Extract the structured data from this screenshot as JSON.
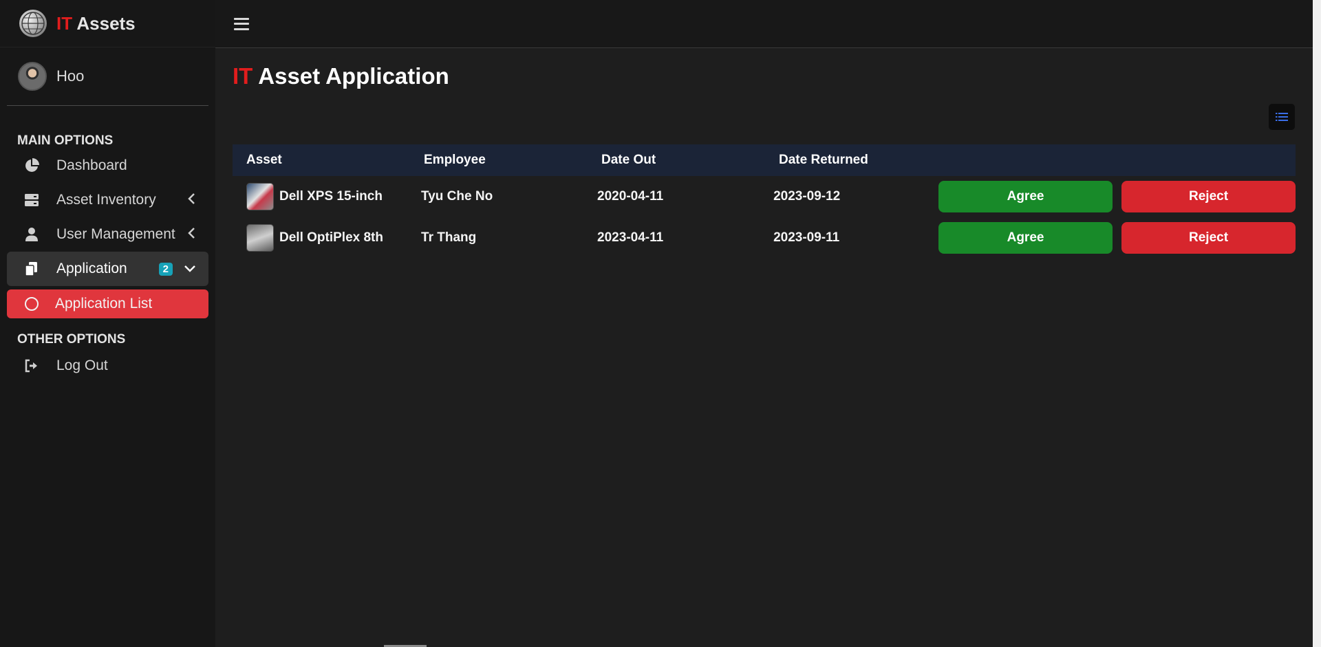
{
  "brand": {
    "accent": "IT",
    "rest": " Assets"
  },
  "user": {
    "name": "Hoo"
  },
  "nav": {
    "main_header": "MAIN OPTIONS",
    "other_header": "OTHER OPTIONS",
    "items": [
      {
        "label": "Dashboard",
        "icon": "pie-chart-icon"
      },
      {
        "label": "Asset Inventory",
        "icon": "server-icon"
      },
      {
        "label": "User Management",
        "icon": "user-icon"
      },
      {
        "label": "Application",
        "icon": "copy-icon",
        "badge": "2"
      }
    ],
    "sub_item": {
      "label": "Application List",
      "icon": "circle-icon"
    },
    "logout": {
      "label": "Log Out",
      "icon": "sign-out-icon"
    }
  },
  "page": {
    "title_accent": "IT",
    "title_rest": " Asset Application"
  },
  "table": {
    "headers": [
      "Asset",
      "Employee",
      "Date Out",
      "Date Returned"
    ],
    "rows": [
      {
        "asset": "Dell XPS 15-inch",
        "employee": "Tyu Che No",
        "date_out": "2020-04-11",
        "date_returned": "2023-09-12",
        "agree": "Agree",
        "reject": "Reject"
      },
      {
        "asset": "Dell OptiPlex 8th",
        "employee": "Tr Thang",
        "date_out": "2023-04-11",
        "date_returned": "2023-09-11",
        "agree": "Agree",
        "reject": "Reject"
      }
    ]
  },
  "colors": {
    "accent_red": "#e11d1d",
    "agree_green": "#188a29",
    "reject_red": "#d7262d",
    "active_sub": "#e0363d",
    "badge": "#17a2b8",
    "table_header": "#1b2437"
  }
}
